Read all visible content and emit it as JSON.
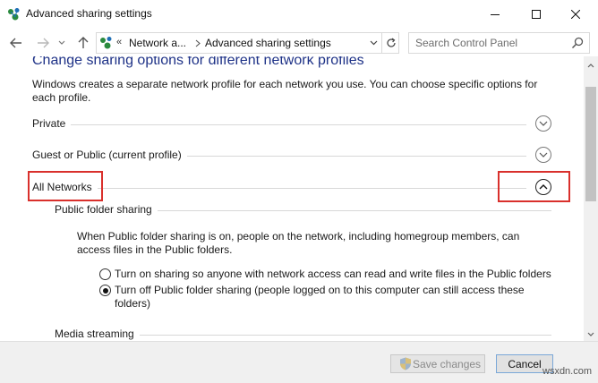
{
  "window": {
    "title": "Advanced sharing settings",
    "icon": "network-sharing-icon"
  },
  "nav": {
    "breadcrumb_chevron": "«",
    "breadcrumb": [
      "Network a...",
      "Advanced sharing settings"
    ],
    "search_placeholder": "Search Control Panel"
  },
  "content": {
    "heading": "Change sharing options for different network profiles",
    "description": "Windows creates a separate network profile for each network you use. You can choose specific options for each profile.",
    "profiles": [
      {
        "label": "Private",
        "state": "collapsed"
      },
      {
        "label": "Guest or Public (current profile)",
        "state": "collapsed"
      },
      {
        "label": "All Networks",
        "state": "expanded"
      }
    ],
    "public_folder_sharing": {
      "title": "Public folder sharing",
      "description": "When Public folder sharing is on, people on the network, including homegroup members, can access files in the Public folders.",
      "options": [
        {
          "label": "Turn on sharing so anyone with network access can read and write files in the Public folders",
          "selected": false
        },
        {
          "label": "Turn off Public folder sharing (people logged on to this computer can still access these folders)",
          "selected": true
        }
      ]
    },
    "media_streaming": {
      "title": "Media streaming"
    }
  },
  "footer": {
    "save_label": "Save changes",
    "cancel_label": "Cancel"
  },
  "watermark": "wsxdn.com",
  "colors": {
    "heading": "#1e3287",
    "highlight": "#d9302c",
    "footer_bg": "#f0f0f0"
  }
}
